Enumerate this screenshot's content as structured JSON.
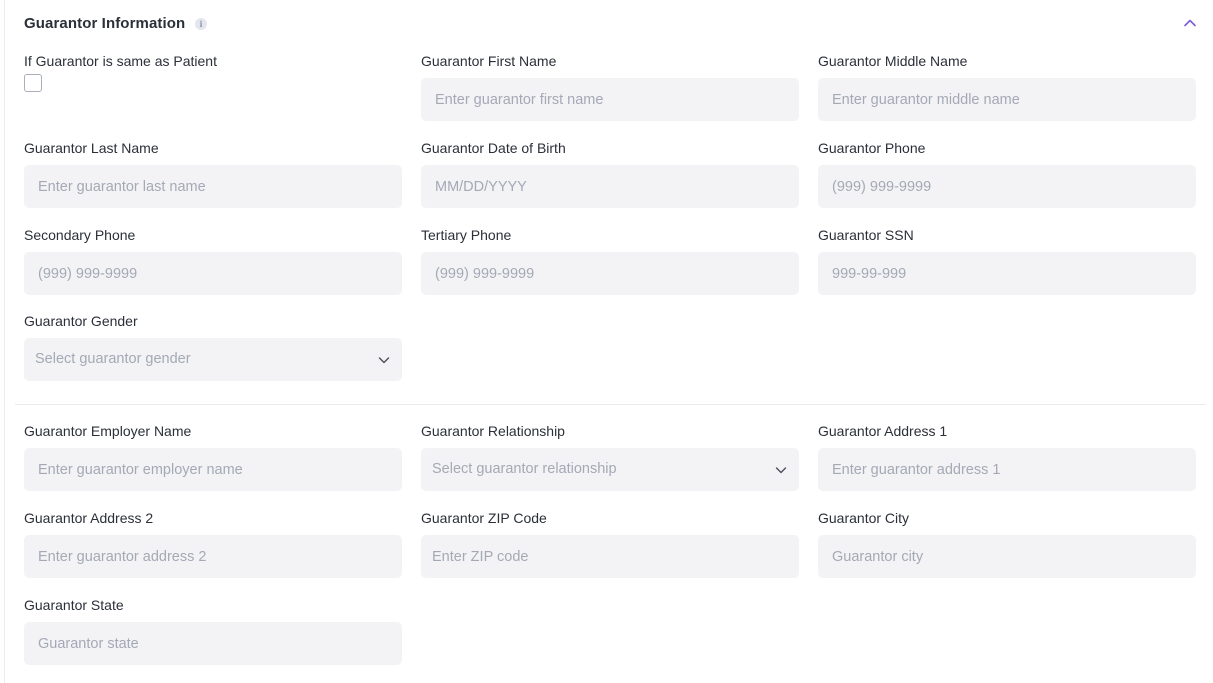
{
  "header": {
    "title": "Guarantor Information",
    "info_glyph": "i",
    "info_icon": "info-icon",
    "collapse_icon": "chevron-up-icon"
  },
  "accent_color": "#7c5cd6",
  "same_as_patient": {
    "label": "If Guarantor is same as Patient",
    "checked": false
  },
  "fields": {
    "first_name": {
      "label": "Guarantor First Name",
      "placeholder": "Enter guarantor first name"
    },
    "middle_name": {
      "label": "Guarantor Middle Name",
      "placeholder": "Enter guarantor middle name"
    },
    "last_name": {
      "label": "Guarantor Last Name",
      "placeholder": "Enter guarantor last name"
    },
    "dob": {
      "label": "Guarantor Date of Birth",
      "placeholder": "MM/DD/YYYY"
    },
    "phone": {
      "label": "Guarantor Phone",
      "placeholder": "(999) 999-9999"
    },
    "secondary_phone": {
      "label": "Secondary Phone",
      "placeholder": "(999) 999-9999"
    },
    "tertiary_phone": {
      "label": "Tertiary Phone",
      "placeholder": "(999) 999-9999"
    },
    "ssn": {
      "label": "Guarantor SSN",
      "placeholder": "999-99-999"
    },
    "gender": {
      "label": "Guarantor Gender",
      "placeholder": "Select guarantor gender"
    },
    "employer": {
      "label": "Guarantor Employer Name",
      "placeholder": "Enter guarantor employer name"
    },
    "relationship": {
      "label": "Guarantor Relationship",
      "placeholder": "Select guarantor relationship"
    },
    "address1": {
      "label": "Guarantor Address 1",
      "placeholder": "Enter guarantor address 1"
    },
    "address2": {
      "label": "Guarantor Address 2",
      "placeholder": "Enter guarantor address 2"
    },
    "zip": {
      "label": "Guarantor ZIP Code",
      "placeholder": "Enter ZIP code"
    },
    "city": {
      "label": "Guarantor City",
      "placeholder": "Guarantor city"
    },
    "state": {
      "label": "Guarantor State",
      "placeholder": "Guarantor state"
    }
  }
}
